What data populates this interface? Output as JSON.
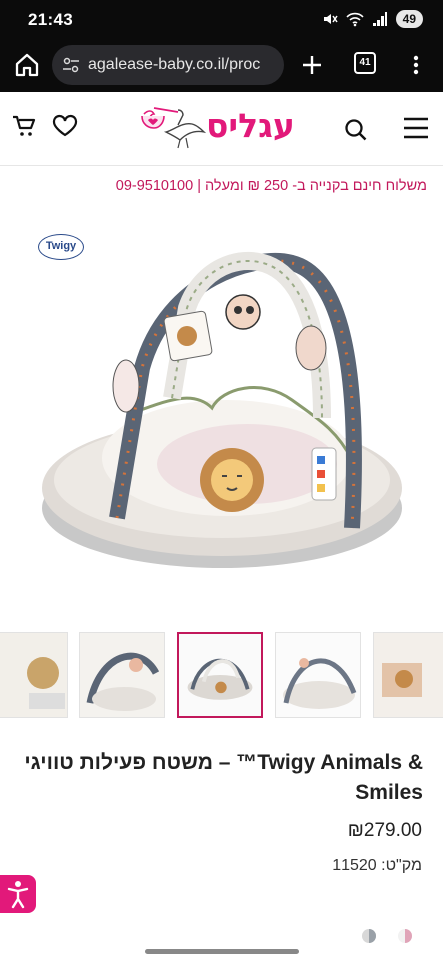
{
  "status_bar": {
    "time": "21:43",
    "battery": "49"
  },
  "browser": {
    "url": "agalease-baby.co.il/proc",
    "tab_count": "41"
  },
  "header": {
    "logo_text": "עגליס"
  },
  "promo": {
    "text": "משלוח חינם בקנייה ב- 250 ₪ ומעלה | 09-9510100"
  },
  "gallery": {
    "brand_badge": "Twigy",
    "thumbnail_count": 5,
    "active_thumbnail": 3
  },
  "product": {
    "title": "משטח פעילות טוויגי – ™Twigy Animals & Smiles",
    "price": "₪279.00",
    "sku": "מק\"ט: 11520"
  },
  "colors": {
    "brand_pink": "#e2197a",
    "promo_pink": "#c2185b",
    "dark_bar": "#0b0b0b"
  }
}
